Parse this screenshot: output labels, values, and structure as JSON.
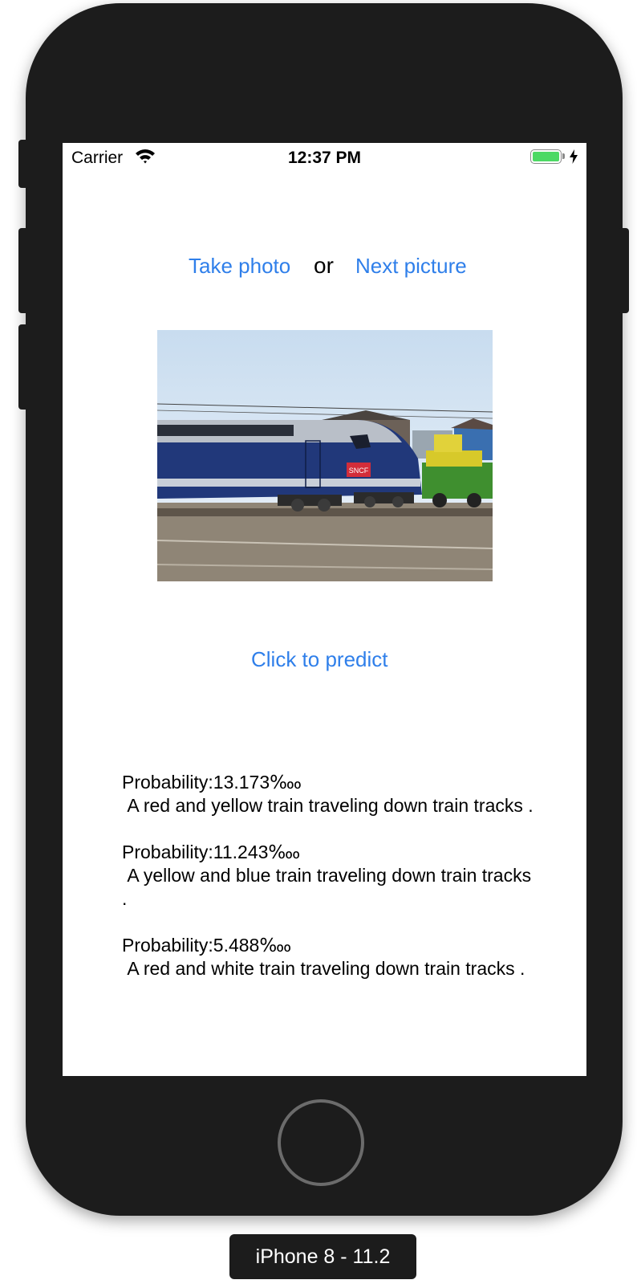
{
  "status_bar": {
    "carrier": "Carrier",
    "time": "12:37 PM",
    "wifi_icon": "wifi-icon",
    "battery_icon": "battery-icon",
    "charging_icon": "charging-bolt-icon",
    "battery_level": 1.0
  },
  "toolbar": {
    "take_photo_label": "Take photo",
    "or_label": "or",
    "next_picture_label": "Next picture"
  },
  "photo": {
    "subject": "blue-sncf-high-speed-train-photo",
    "logo_text": "SNCF"
  },
  "predict": {
    "label": "Click to predict"
  },
  "results": [
    {
      "probability": "Probability:13.173‱",
      "caption": " A red and yellow train traveling down train tracks ."
    },
    {
      "probability": "Probability:11.243‱",
      "caption": " A yellow and blue train traveling down train tracks ."
    },
    {
      "probability": "Probability:5.488‱",
      "caption": " A red and white train traveling down train tracks ."
    }
  ],
  "device": {
    "label": "iPhone 8 - 11.2"
  },
  "colors": {
    "link": "#2f7fea",
    "bezel": "#1c1c1c",
    "battery": "#4cd964"
  }
}
